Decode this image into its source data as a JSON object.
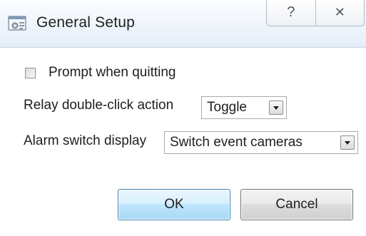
{
  "window": {
    "title": "General Setup",
    "icon": "settings-window-icon",
    "help_glyph": "?",
    "close_glyph": "✕"
  },
  "options": {
    "prompt_quit": {
      "label": "Prompt when quitting",
      "checked": false
    },
    "relay": {
      "label": "Relay double-click action",
      "value": "Toggle"
    },
    "alarm": {
      "label": "Alarm switch display",
      "value": "Switch event cameras"
    }
  },
  "buttons": {
    "ok": "OK",
    "cancel": "Cancel"
  },
  "colors": {
    "ok_border": "#3c7fb1",
    "ok_fill": "#bee6fd",
    "cancel_border": "#707070"
  }
}
